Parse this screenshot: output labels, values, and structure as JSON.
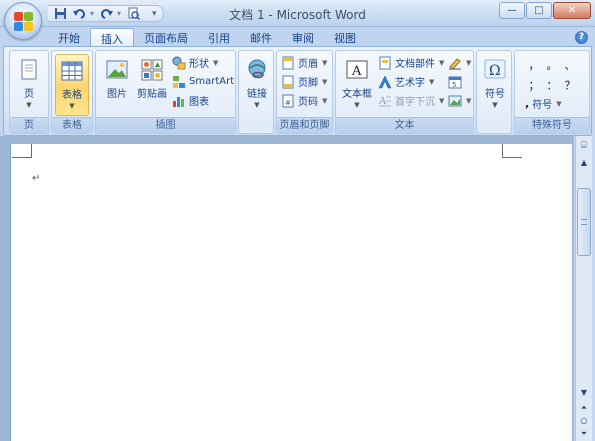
{
  "window": {
    "title": "文档 1 - Microsoft Word",
    "controls": {
      "minimize": "—",
      "maximize": "□",
      "close": "✕"
    }
  },
  "quick_access": {
    "save_icon": "save-icon",
    "undo_icon": "undo-icon",
    "redo_icon": "redo-icon",
    "print_preview_icon": "print-preview-icon",
    "customize_icon": "customize-arrow-icon"
  },
  "tabs": [
    "开始",
    "插入",
    "页面布局",
    "引用",
    "邮件",
    "审阅",
    "视图"
  ],
  "active_tab": "插入",
  "ribbon": {
    "pages": {
      "label": "页",
      "button_label": "页"
    },
    "tables": {
      "label": "表格",
      "button_label": "表格"
    },
    "illustrations": {
      "label": "插图",
      "picture": "图片",
      "clipart": "剪贴画",
      "shapes": "形状",
      "smartart": "SmartArt",
      "chart": "图表"
    },
    "links": {
      "button_label": "链接"
    },
    "header_footer": {
      "label": "页眉和页脚",
      "header": "页眉",
      "footer": "页脚",
      "page_number": "页码"
    },
    "text": {
      "label": "文本",
      "textbox": "文本框",
      "quickparts": "文档部件",
      "wordart": "艺术字",
      "dropcap": "首字下沉"
    },
    "symbols": {
      "button_label": "符号"
    },
    "special_chars": {
      "label": "特殊符号",
      "chars": [
        "，",
        "。",
        "、",
        "；",
        "：",
        "？"
      ],
      "button_label": "符号"
    }
  },
  "document": {
    "paragraph_mark": "↵"
  },
  "colors": {
    "ribbon_bg": "#dfeaf8",
    "accent_blue": "#15428b",
    "highlight_orange": "#ffd56b"
  }
}
